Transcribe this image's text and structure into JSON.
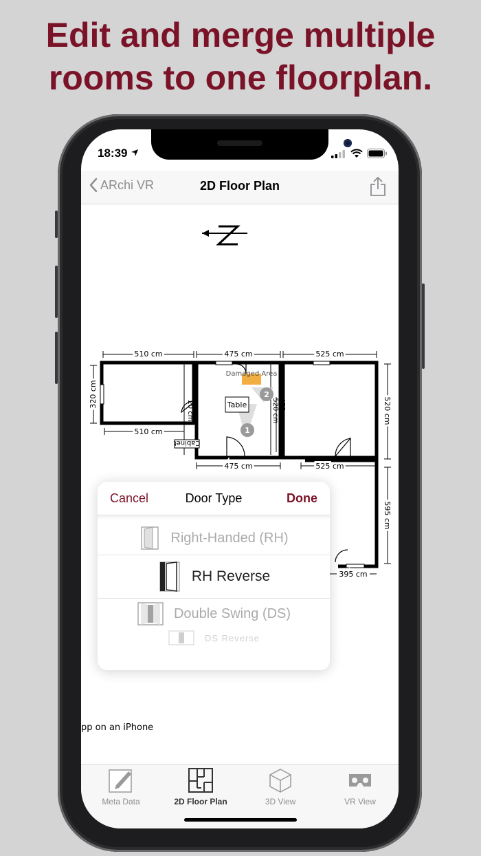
{
  "headline": {
    "line1": "Edit and merge multiple",
    "line2": "rooms to one floorplan."
  },
  "status_bar": {
    "time": "18:39"
  },
  "nav": {
    "back_label": "ARchi VR",
    "title": "2D Floor Plan",
    "share_icon": "share-icon"
  },
  "floorplan": {
    "dimensions": {
      "top_left": "510 cm",
      "top_mid": "475 cm",
      "top_right": "525 cm",
      "left_height": "320 cm",
      "room1_bottom": "510 cm",
      "room2_bottom": "475 cm",
      "room3_bottom": "525 cm",
      "right_height": "520 cm",
      "right_lower": "595 cm",
      "bottom_small": "395 cm",
      "inner_20": "20 cm",
      "inner_520": "520 cm",
      "inner_475": "475 cm"
    },
    "labels": {
      "table": "Table",
      "cabinet": "Cabinet",
      "damaged_area": "Damaged Area",
      "marker1": "1",
      "marker2": "2"
    },
    "footer_text": "pp on an iPhone"
  },
  "door_picker": {
    "cancel": "Cancel",
    "title": "Door Type",
    "done": "Done",
    "options": [
      {
        "label": "Right-Handed (RH)",
        "state": "dim"
      },
      {
        "label": "RH Reverse",
        "state": "selected"
      },
      {
        "label": "Double Swing (DS)",
        "state": "dim"
      },
      {
        "label": "DS Reverse",
        "state": "faint"
      }
    ]
  },
  "tabbar": {
    "tabs": [
      {
        "label": "Meta Data",
        "icon": "pencil-note-icon"
      },
      {
        "label": "2D Floor Plan",
        "icon": "floorplan-icon",
        "active": true
      },
      {
        "label": "3D View",
        "icon": "cube-icon"
      },
      {
        "label": "VR View",
        "icon": "vr-headset-icon"
      }
    ]
  },
  "colors": {
    "accent": "#7a1228",
    "background": "#d4d4d4",
    "marker_orange": "#f0a020"
  }
}
